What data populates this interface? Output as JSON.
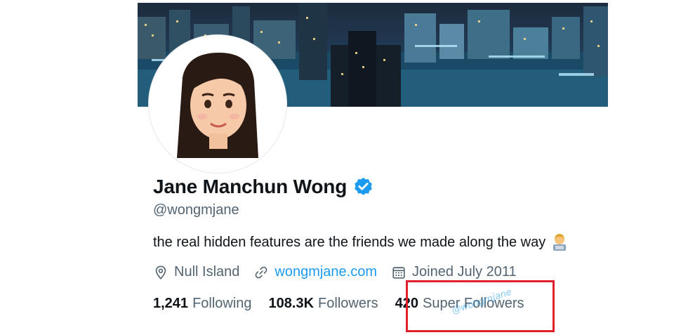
{
  "profile": {
    "name": "Jane Manchun Wong",
    "handle": "@wongmjane",
    "bio": "the real hidden features are the friends we made along the way",
    "verified_icon": "verified-badge-icon",
    "bio_emoji": "woman-technologist-emoji"
  },
  "meta": {
    "location": "Null Island",
    "website": "wongmjane.com",
    "joined": "Joined July 2011"
  },
  "stats": {
    "following_count": "1,241",
    "following_label": "Following",
    "followers_count": "108.3K",
    "followers_label": "Followers",
    "super_count": "420",
    "super_label": "Super Followers"
  },
  "watermark": "@wongmjane",
  "colors": {
    "accent": "#1d9bf0",
    "secondary_text": "#536471",
    "highlight": "#e0202a"
  }
}
